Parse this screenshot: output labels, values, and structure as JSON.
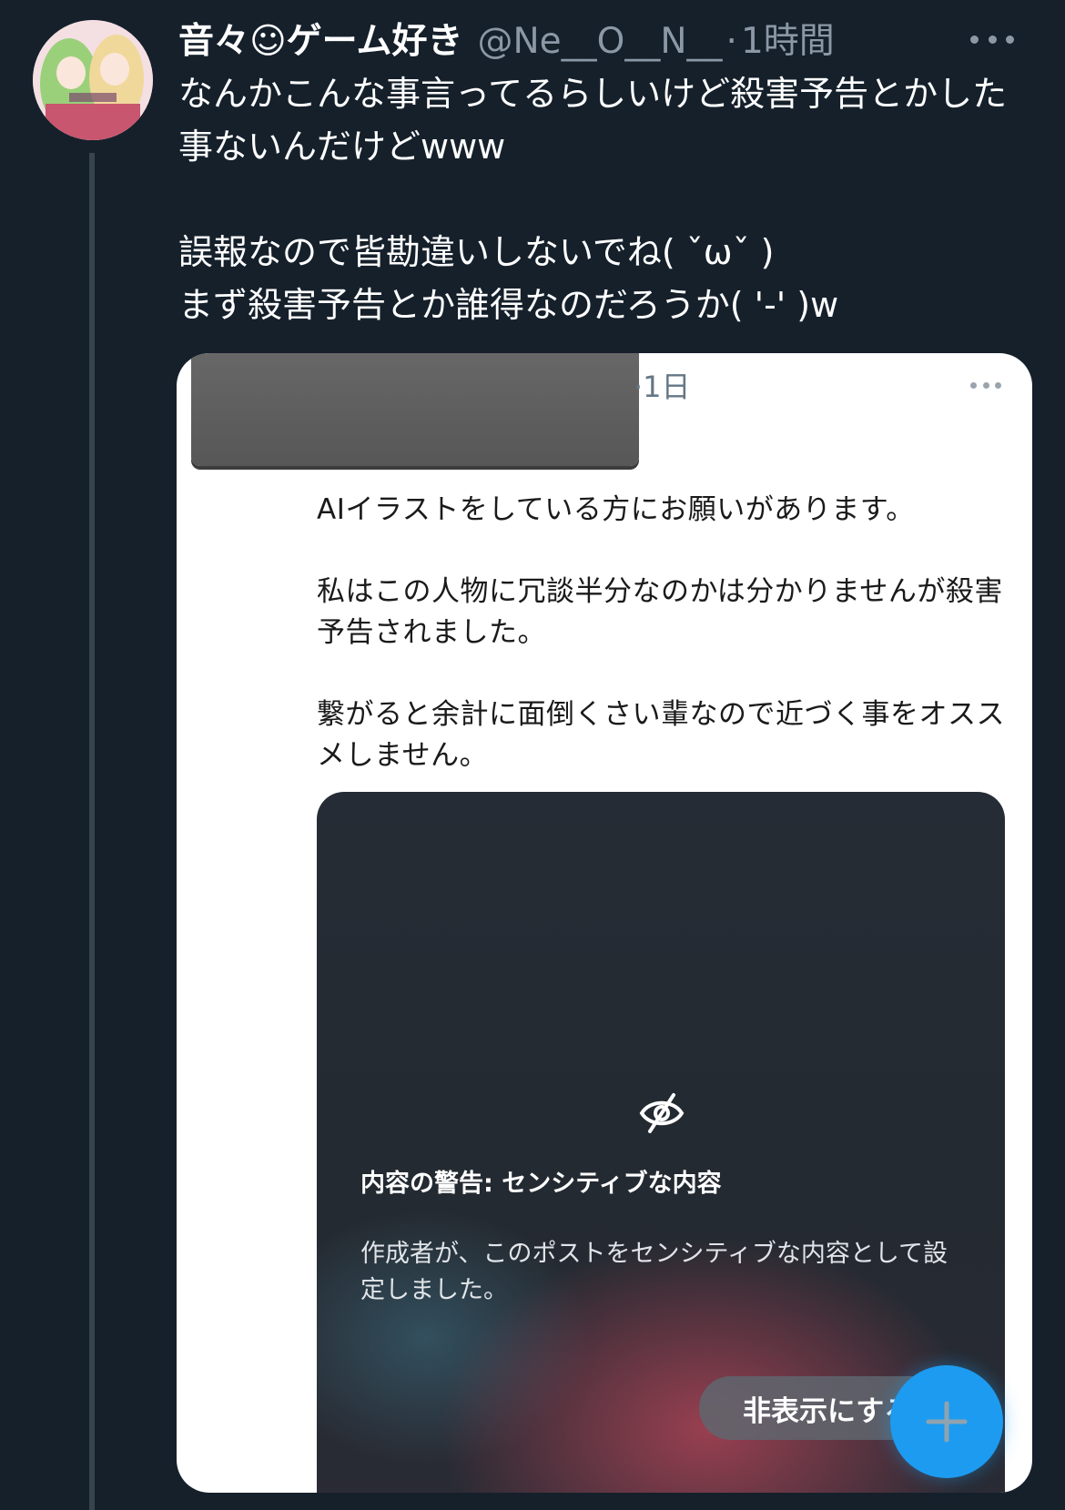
{
  "tweet": {
    "display_name": "音々☺ゲーム好き",
    "handle": "@Ne__O__N__",
    "separator": "·",
    "time": "1時間",
    "avatar_icon": "user-avatar",
    "body": [
      "なんかこんな事言ってるらしいけど殺害予告とかした事ないんだけどwww",
      "誤報なので皆勘違いしないでね( ˇωˇ )\nまず殺害予告とか誰得なのだろうか(  '-' )w"
    ]
  },
  "quote": {
    "time": "·1日",
    "body": [
      "AIイラストをしている方にお願いがあります。",
      "私はこの人物に冗談半分なのかは分かりませんが殺害予告されました。",
      "繋がると余計に面倒くさい輩なので近づく事をオススメしません。"
    ],
    "media": {
      "warning_icon": "eye-slash-icon",
      "warning_title": "内容の警告: センシティブな内容",
      "warning_text": "作成者が、このポストをセンシティブな内容として設定しました。",
      "hide_button": "非表示にする"
    }
  },
  "fab": {
    "icon": "plus-icon",
    "color": "#1d9bf0"
  },
  "colors": {
    "background": "#15202b",
    "muted": "#8b98a5",
    "accent": "#1d9bf0"
  }
}
